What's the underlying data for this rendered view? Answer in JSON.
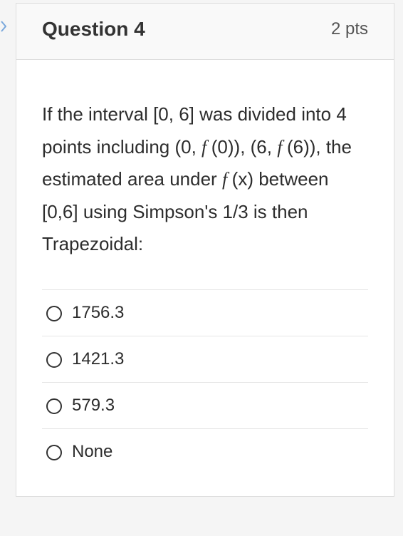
{
  "question": {
    "title": "Question 4",
    "points": "2 pts",
    "text_parts": {
      "p1": "If the interval [0, 6] was divided into 4 points including (0, ",
      "f1": "f ",
      "p2": "(0)), (6, ",
      "f2": "f ",
      "p3": "(6)), the estimated area under ",
      "f3": "f ",
      "p4": "(x) between [0,6] using Simpson's 1/3 is then Trapezoidal:"
    },
    "options": [
      {
        "label": "1756.3"
      },
      {
        "label": "1421.3"
      },
      {
        "label": "579.3"
      },
      {
        "label": "None"
      }
    ]
  }
}
